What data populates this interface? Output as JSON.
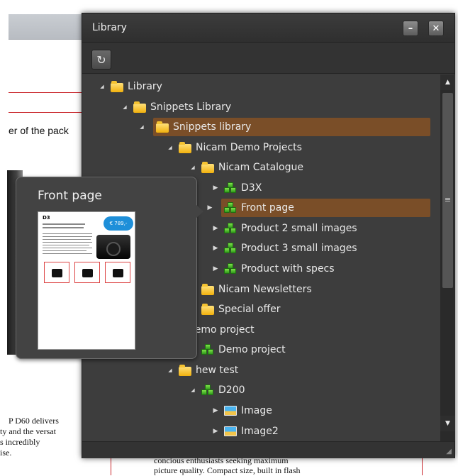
{
  "document": {
    "text_top": "er of the pack",
    "text_bottom_lines": [
      "P D60 delivers",
      "ty and the versat",
      "s incredibly",
      "ise."
    ],
    "text_bottom_box_lines": [
      "concious enthusiasts seeking maximum",
      "picture quality. Compact size, built in flash"
    ]
  },
  "panel": {
    "title": "Library",
    "minimize_label": "–",
    "close_label": "✕",
    "refresh_icon": "↻",
    "scroll_up": "▲",
    "scroll_down": "▼",
    "scroll_grip": "≡",
    "resize_grip": "◢"
  },
  "tree": [
    {
      "label": "Library",
      "type": "folder",
      "expanded": true
    },
    {
      "label": "Snippets Library",
      "type": "folder",
      "expanded": true
    },
    {
      "label": "Snippets library",
      "type": "folder",
      "expanded": true,
      "selected": true
    },
    {
      "label": "Nicam Demo Projects",
      "type": "folder",
      "expanded": true
    },
    {
      "label": "Nicam Catalogue",
      "type": "folder",
      "expanded": true
    },
    {
      "label": "D3X",
      "type": "snippet",
      "expanded": false
    },
    {
      "label": "Front page",
      "type": "snippet",
      "expanded": false,
      "hovered": true
    },
    {
      "label": "Product 2 small images",
      "type": "snippet",
      "expanded": false
    },
    {
      "label": "Product 3 small images",
      "type": "snippet",
      "expanded": false
    },
    {
      "label": "Product with specs",
      "type": "snippet",
      "expanded": false
    },
    {
      "label": "Nicam Newsletters",
      "type": "folder"
    },
    {
      "label": "Special offer",
      "type": "folder"
    },
    {
      "label": "Demo project",
      "type": "text"
    },
    {
      "label": "Demo project",
      "type": "snippet"
    },
    {
      "label": "hew test",
      "type": "folder",
      "expanded": true
    },
    {
      "label": "D200",
      "type": "snippet",
      "expanded": true
    },
    {
      "label": "Image",
      "type": "image",
      "expanded": false
    },
    {
      "label": "Image2",
      "type": "image",
      "expanded": false
    }
  ],
  "tooltip": {
    "title": "Front page",
    "thumb_heading": "D3",
    "thumb_price": "€ 789,-"
  },
  "colors": {
    "panel_bg": "#3d3d3d",
    "selection": "#7a4e28",
    "folder": "#f2b10d",
    "snippet": "#2f9a1a",
    "doc_rule": "#c9252b"
  }
}
